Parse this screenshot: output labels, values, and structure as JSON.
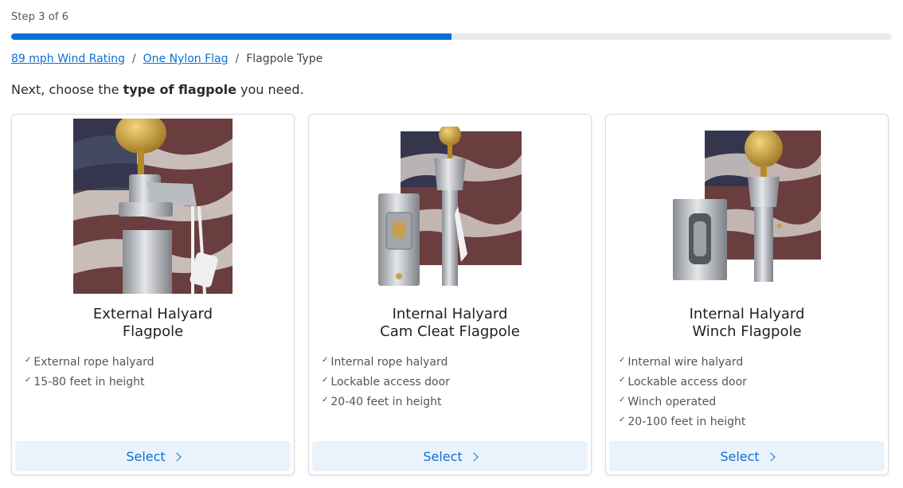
{
  "progress": {
    "step_label": "Step 3 of 6",
    "fraction": 0.5
  },
  "breadcrumb": {
    "items": [
      {
        "label": "89 mph Wind Rating",
        "link": true
      },
      {
        "label": "One Nylon Flag",
        "link": true
      },
      {
        "label": "Flagpole Type",
        "link": false
      }
    ],
    "separator": "/"
  },
  "intro": {
    "prefix": "Next, choose the ",
    "bold": "type of flagpole",
    "suffix": " you need."
  },
  "cards": [
    {
      "title_line1": "External Halyard",
      "title_line2": "Flagpole",
      "image_icon": "external-halyard-flagpole-photo",
      "features": [
        "External rope halyard",
        "15-80 feet in height"
      ],
      "button_label": "Select"
    },
    {
      "title_line1": "Internal Halyard",
      "title_line2": "Cam Cleat Flagpole",
      "image_icon": "cam-cleat-flagpole-photo",
      "features": [
        "Internal rope halyard",
        "Lockable access door",
        "20-40 feet in height"
      ],
      "button_label": "Select"
    },
    {
      "title_line1": "Internal Halyard",
      "title_line2": "Winch Flagpole",
      "image_icon": "winch-flagpole-photo",
      "features": [
        "Internal wire halyard",
        "Lockable access door",
        "Winch operated",
        "20-100 feet in height"
      ],
      "button_label": "Select"
    }
  ],
  "colors": {
    "accent": "#0a6fd6",
    "button_bg": "#eaf3fc",
    "track": "#e6e9ee"
  }
}
